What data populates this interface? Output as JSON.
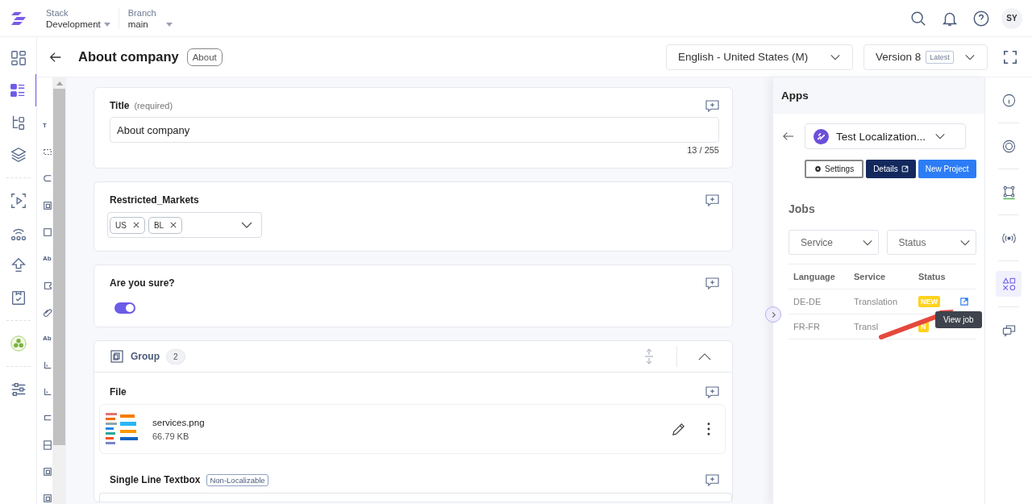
{
  "header": {
    "stack_label": "Stack",
    "stack": "Development",
    "branch_label": "Branch",
    "branch": "main",
    "avatar": "SY"
  },
  "nav": [
    {
      "selected": false
    },
    {
      "selected": true
    },
    {
      "selected": false
    },
    {
      "selected": false
    },
    {
      "selected": false
    },
    {
      "selected": false
    },
    {
      "selected": false
    },
    {
      "selected": false
    },
    {
      "selected": false
    },
    {
      "selected": false
    }
  ],
  "page": {
    "title": "About company",
    "content_type": "About",
    "locale": "English - United States (M)",
    "version": "Version 8",
    "version_tag": "Latest"
  },
  "palette": [
    {
      "kind": "text",
      "text": "T"
    },
    {
      "kind": "shape"
    },
    {
      "kind": "shape"
    },
    {
      "kind": "shape"
    },
    {
      "kind": "shape"
    },
    {
      "kind": "text",
      "text": "Ab"
    },
    {
      "kind": "shape"
    },
    {
      "kind": "shape"
    },
    {
      "kind": "text",
      "text": "Ab"
    },
    {
      "kind": "shape"
    },
    {
      "kind": "shape"
    },
    {
      "kind": "shape"
    },
    {
      "kind": "shape"
    },
    {
      "kind": "shape"
    },
    {
      "kind": "shape"
    }
  ],
  "fields": [
    {
      "kind": "text",
      "label": "Title",
      "hint": "(required)",
      "value": "About company",
      "counter": "13 / 255"
    },
    {
      "kind": "multiselect",
      "label": "Restricted_Markets",
      "chips": [
        "US",
        "BL"
      ]
    },
    {
      "kind": "toggle",
      "label": "Are you sure?",
      "on": true
    },
    {
      "kind": "group",
      "label": "Group",
      "count": "2",
      "expanded": true,
      "children": [
        {
          "kind": "file",
          "label": "File",
          "name": "services.png",
          "size": "66.79 KB"
        },
        {
          "kind": "textline",
          "label": "Single Line Textbox",
          "tag": "Non-Localizable"
        }
      ]
    }
  ],
  "apps": {
    "title": "Apps",
    "app": "Test Localization...",
    "buttons": [
      {
        "kind": "outline",
        "label": "Settings"
      },
      {
        "kind": "dark",
        "label": "Details"
      },
      {
        "kind": "primary",
        "label": "New Project"
      }
    ],
    "jobs_title": "Jobs",
    "filters": [
      "Service",
      "Status"
    ],
    "columns": [
      "Language",
      "Service",
      "Status"
    ],
    "rows": [
      {
        "language": "DE-DE",
        "service": "Translation",
        "status": "NEW",
        "hovered": true
      },
      {
        "language": "FR-FR",
        "service": "Transl",
        "status": "N",
        "hovered": false
      }
    ],
    "tooltip": "View job"
  },
  "rail": [
    {
      "selected": false
    },
    {
      "selected": false
    },
    {
      "selected": false
    },
    {
      "selected": false
    },
    {
      "selected": true
    },
    {
      "selected": false
    }
  ]
}
